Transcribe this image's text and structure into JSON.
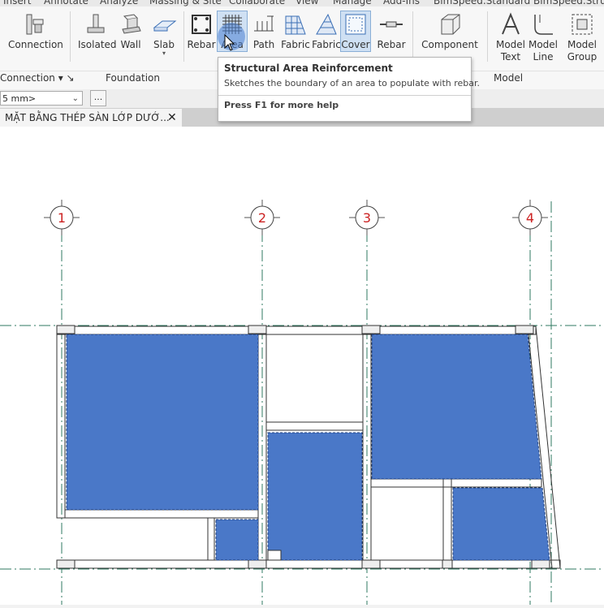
{
  "menu": [
    "Insert",
    "Annotate",
    "Analyze",
    "Massing & Site",
    "Collaborate",
    "View",
    "Manage",
    "Add-Ins",
    "BimSpeed.Standard",
    "BimSpeed.Struct"
  ],
  "ribbon": {
    "buttons": {
      "connection": "Connection",
      "isolated": "Isolated",
      "wall": "Wall",
      "slab": "Slab",
      "rebar": "Rebar",
      "area": "Area",
      "path": "Path",
      "fabric1": "Fabric",
      "fabric2": "Fabric",
      "cover": "Cover",
      "rebar2": "Rebar",
      "component": "Component",
      "model_text_1": "Model",
      "model_text_2": "Text",
      "model_line_1": "Model",
      "model_line_2": "Line",
      "model_group_1": "Model",
      "model_group_2": "Group"
    },
    "panels": {
      "connection": "Connection ▾ ↘",
      "foundation": "Foundation",
      "model": "Model"
    },
    "accent": "#4a80d2"
  },
  "options_bar": {
    "combo_value": "5 mm>",
    "dots_label": "..."
  },
  "view_tab": {
    "title": "MẶT BẰNG THÉP SÀN LỚP DƯỚ...",
    "close": "✕"
  },
  "tooltip": {
    "title": "Structural Area Reinforcement",
    "description": "Sketches the boundary of an area to populate with rebar.",
    "help": "Press F1 for more help"
  },
  "grids": {
    "labels": [
      "1",
      "2",
      "3",
      "4"
    ],
    "bubble_text_color": "#cc2222"
  },
  "colors": {
    "area_fill": "#4a78c8",
    "grid_line": "#2f7a60"
  }
}
